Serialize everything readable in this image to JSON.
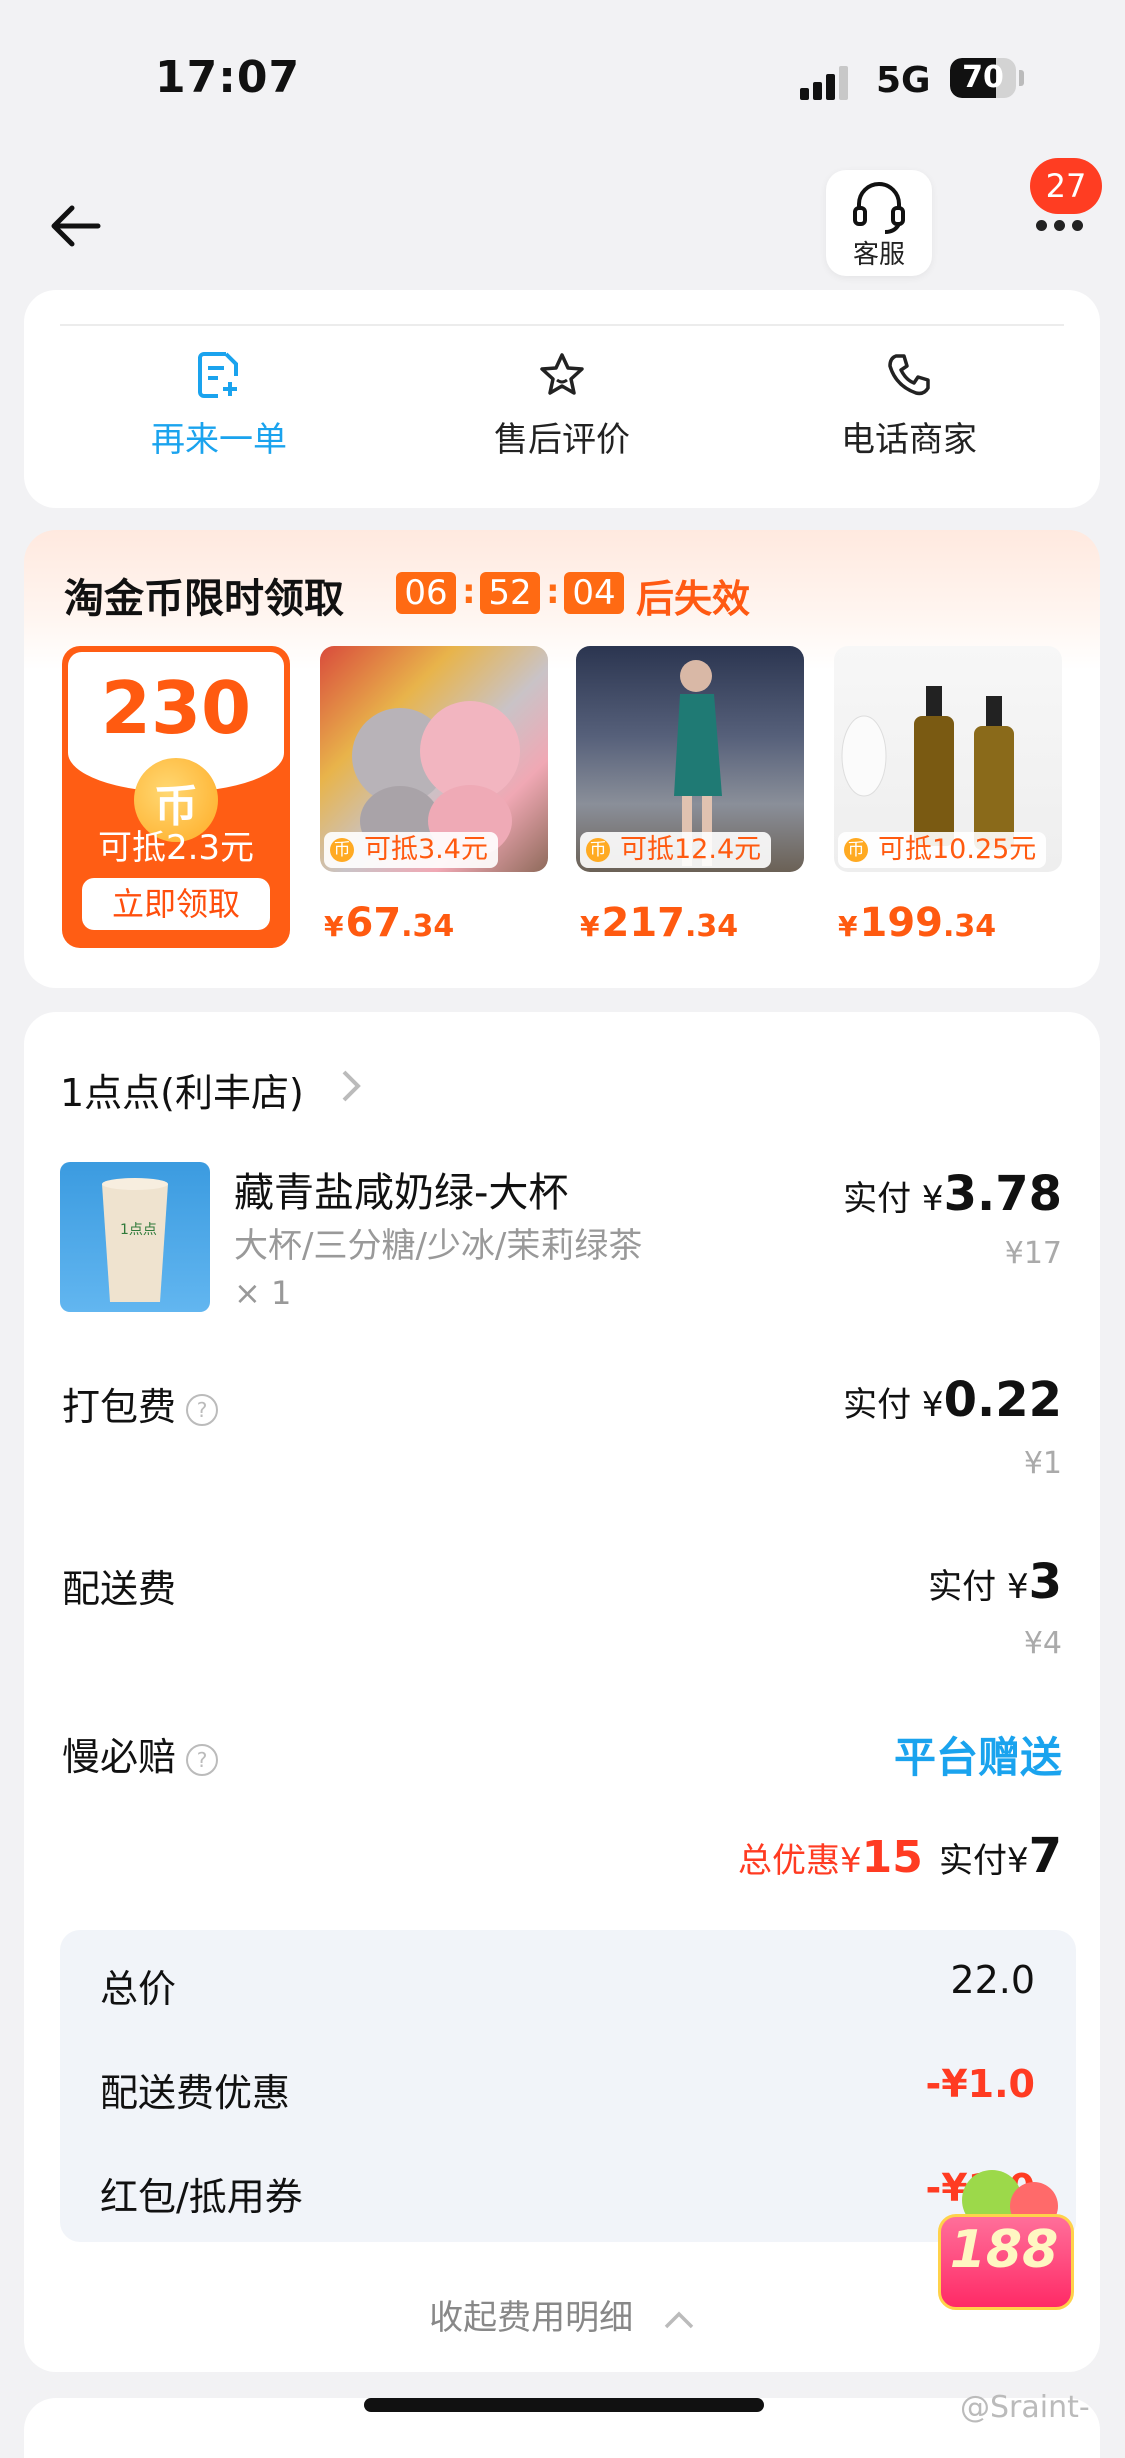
{
  "status_bar": {
    "time": "17:07",
    "network": "5G",
    "battery": "70",
    "battery_level": 0.7
  },
  "header": {
    "customer_service_label": "客服",
    "notification_count": "27"
  },
  "actions": [
    {
      "label": "再来一单",
      "icon": "order-add-icon"
    },
    {
      "label": "售后评价",
      "icon": "star-icon"
    },
    {
      "label": "电话商家",
      "icon": "phone-icon"
    }
  ],
  "coin_promo": {
    "title": "淘金币限时领取",
    "countdown": [
      "06",
      "52",
      "04"
    ],
    "countdown_suffix": "后失效",
    "coin_amount": "230",
    "coin_deduct": "可抵2.3元",
    "claim_label": "立即领取",
    "products": [
      {
        "tag": "可抵3.4元",
        "price_int": "67",
        "price_dec": ".34"
      },
      {
        "tag": "可抵12.4元",
        "price_int": "217",
        "price_dec": ".34"
      },
      {
        "tag": "可抵10.25元",
        "price_int": "199",
        "price_dec": ".34"
      }
    ],
    "currency": "¥"
  },
  "order": {
    "shop_name": "1点点(利丰店)",
    "item": {
      "name": "藏青盐咸奶绿-大杯",
      "spec": "大杯/三分糖/少冰/茉莉绿茶",
      "qty": "× 1",
      "pay_label": "实付 ¥",
      "pay_value": "3.78",
      "original": "¥17"
    },
    "fees": [
      {
        "label": "打包费",
        "pay_label": "实付 ¥",
        "pay_value": "0.22",
        "original": "¥1",
        "has_help": true
      },
      {
        "label": "配送费",
        "pay_label": "实付 ¥",
        "pay_value": "3",
        "original": "¥4",
        "has_help": false
      }
    ],
    "slow_comp": {
      "label": "慢必赔",
      "value": "平台赠送"
    },
    "summary": {
      "discount_label": "总优惠¥",
      "discount_value": "15",
      "pay_label": "实付¥",
      "pay_value": "7"
    },
    "breakdown": [
      {
        "label": "总价",
        "value": "22.0"
      },
      {
        "label": "配送费优惠",
        "value": "-¥1.0"
      },
      {
        "label": "红包/抵用券",
        "value": "-¥1.0"
      }
    ],
    "collapse_label": "收起费用明细"
  },
  "promo_badge": "188",
  "watermark": "@Sraint-",
  "colors": {
    "accent_blue": "#1aa3ee",
    "accent_orange": "#ff5a10",
    "discount_red": "#ff3b22"
  }
}
